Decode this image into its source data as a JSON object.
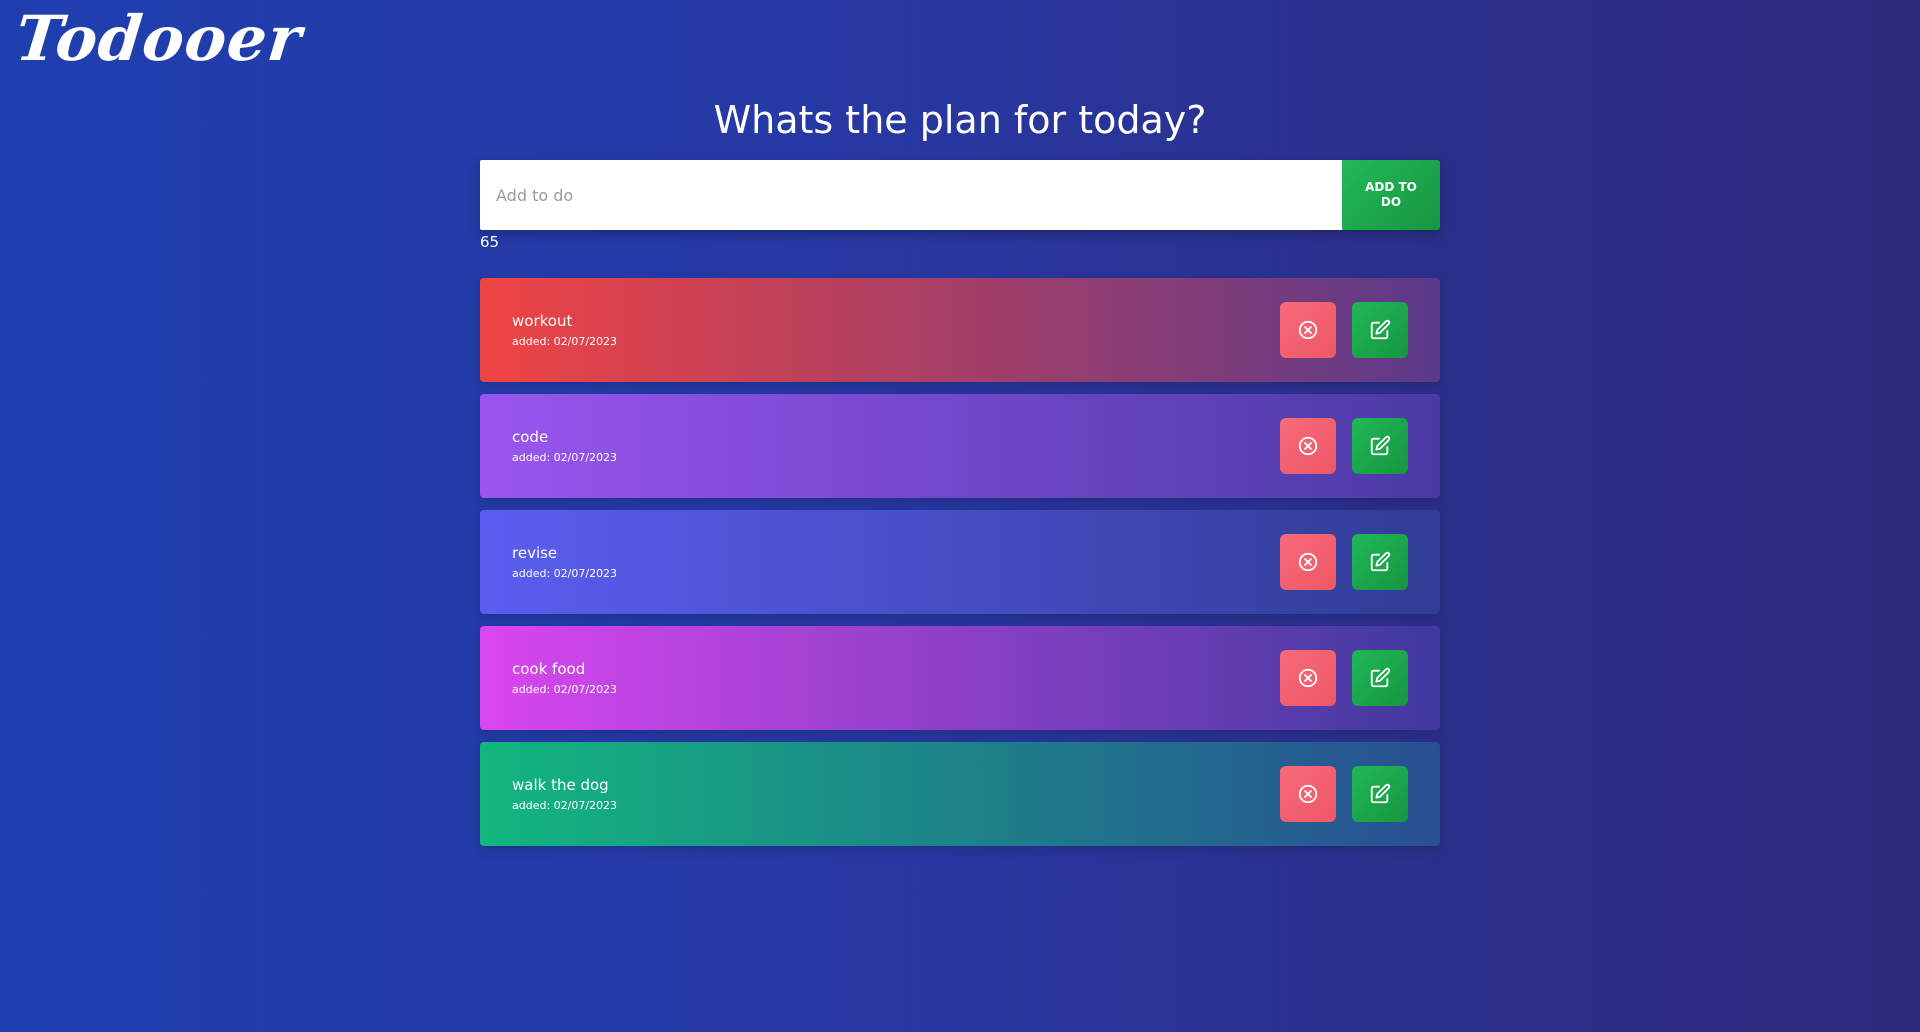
{
  "app": {
    "logo": "Todooer",
    "heading": "Whats the plan for today?"
  },
  "input": {
    "placeholder": "Add to do",
    "value": "",
    "add_button_label": "ADD TO DO"
  },
  "count": "65",
  "todos": [
    {
      "text": "workout",
      "date": "added: 02/07/2023",
      "colors": [
        "#ef4444",
        "#5b3a8a"
      ]
    },
    {
      "text": "code",
      "date": "added: 02/07/2023",
      "colors": [
        "#9a55ee",
        "#4a3aa5"
      ]
    },
    {
      "text": "revise",
      "date": "added: 02/07/2023",
      "colors": [
        "#5a5ef0",
        "#2f3d95"
      ]
    },
    {
      "text": "cook food",
      "date": "added: 02/07/2023",
      "colors": [
        "#d946ef",
        "#3f3a9e"
      ]
    },
    {
      "text": "walk the dog",
      "date": "added: 02/07/2023",
      "colors": [
        "#12b67e",
        "#284f93"
      ]
    }
  ],
  "icons": {
    "delete": "close-circle-icon",
    "edit": "edit-icon"
  },
  "colors": {
    "accent_green": "#1fa84c",
    "delete_red": "#f6636f"
  }
}
